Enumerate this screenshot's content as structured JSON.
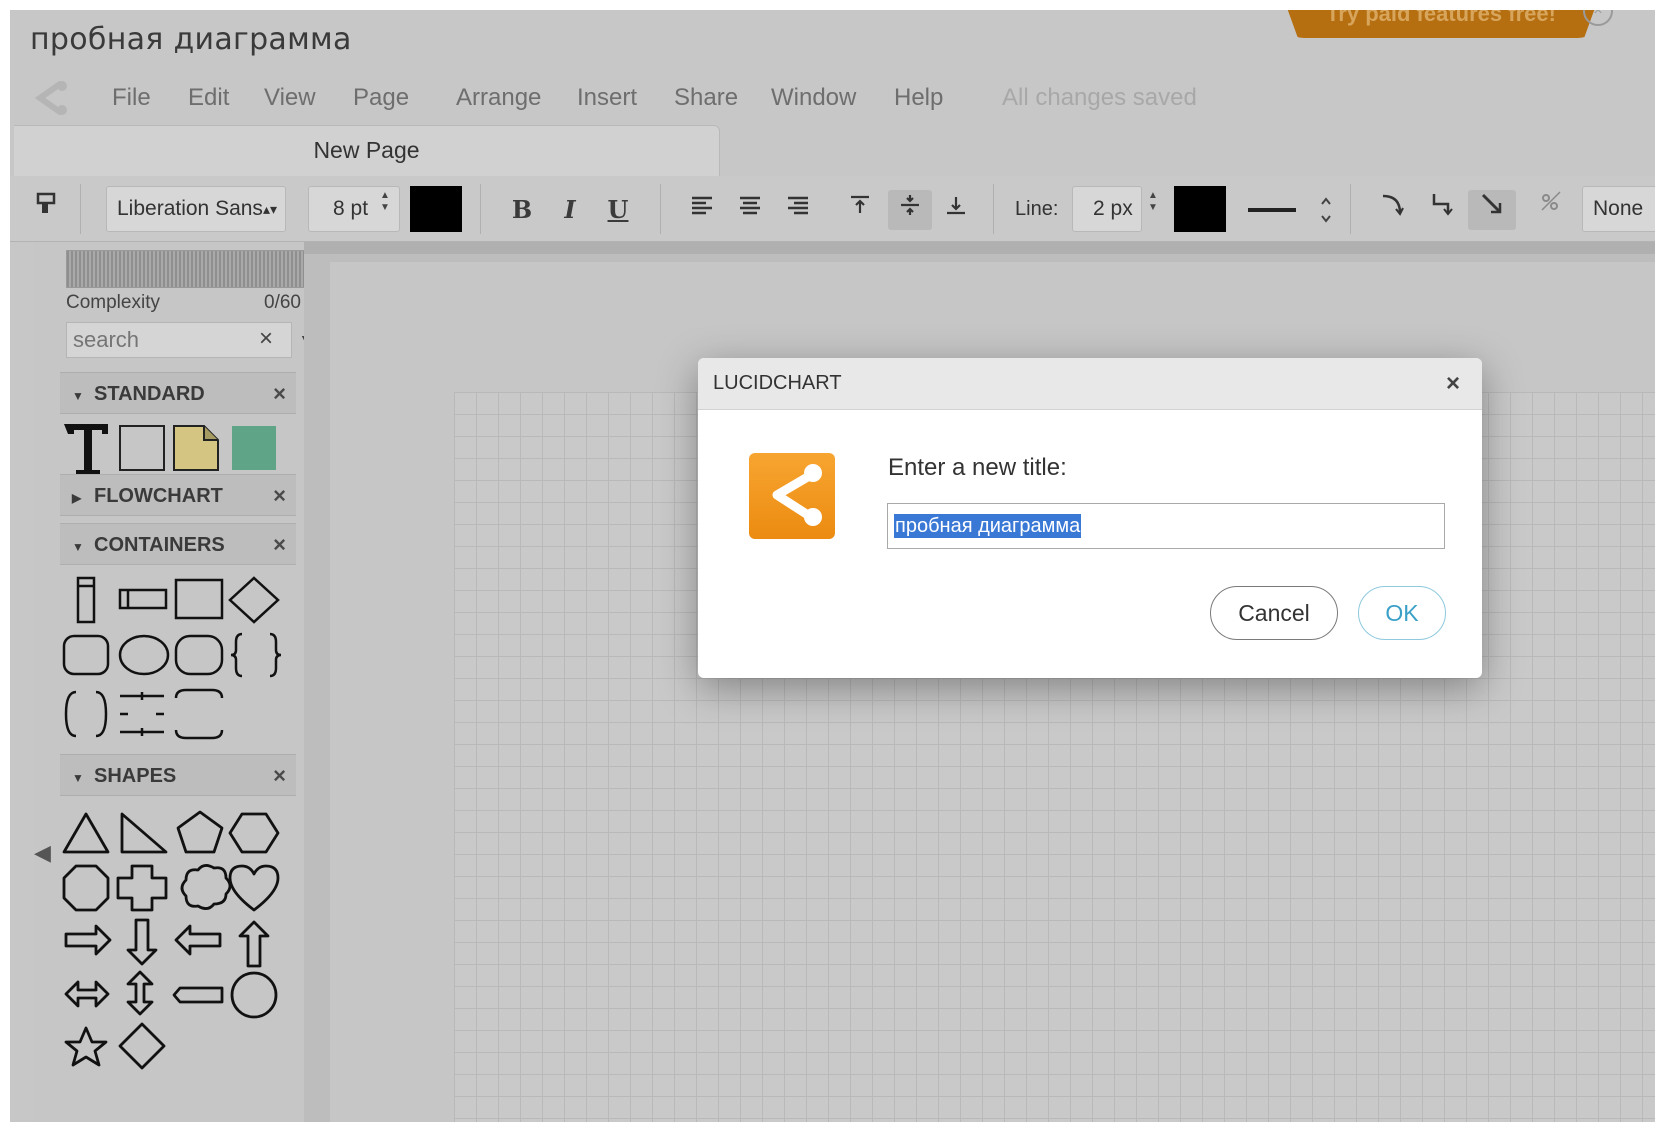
{
  "document": {
    "title": "пробная диаграмма"
  },
  "promo": {
    "label": "Try paid features free!",
    "close": "×"
  },
  "menu": {
    "items": [
      "File",
      "Edit",
      "View",
      "Page",
      "Arrange",
      "Insert",
      "Share",
      "Window",
      "Help"
    ],
    "status": "All changes saved"
  },
  "tabs": {
    "page": "New Page"
  },
  "toolbar": {
    "font_family": "Liberation Sans",
    "font_size": "8 pt",
    "bold": "B",
    "italic": "I",
    "underline": "U",
    "line_label": "Line:",
    "line_width": "2 px",
    "arrow_style": "None",
    "text_color": "#000000",
    "line_color": "#000000"
  },
  "panel": {
    "complexity_label": "Complexity",
    "complexity_value": "0/60",
    "search_placeholder": "search",
    "clear": "×",
    "sections": {
      "standard": "STANDARD",
      "flowchart": "FLOWCHART",
      "containers": "CONTAINERS",
      "shapes": "SHAPES"
    },
    "close": "×"
  },
  "dialog": {
    "title": "LUCIDCHART",
    "close": "×",
    "prompt": "Enter a new title:",
    "value": "пробная диаграмма",
    "cancel": "Cancel",
    "ok": "OK"
  },
  "colors": {
    "accent": "#f29b1b",
    "ok": "#3aa0c8",
    "selection": "#3a78d6"
  }
}
